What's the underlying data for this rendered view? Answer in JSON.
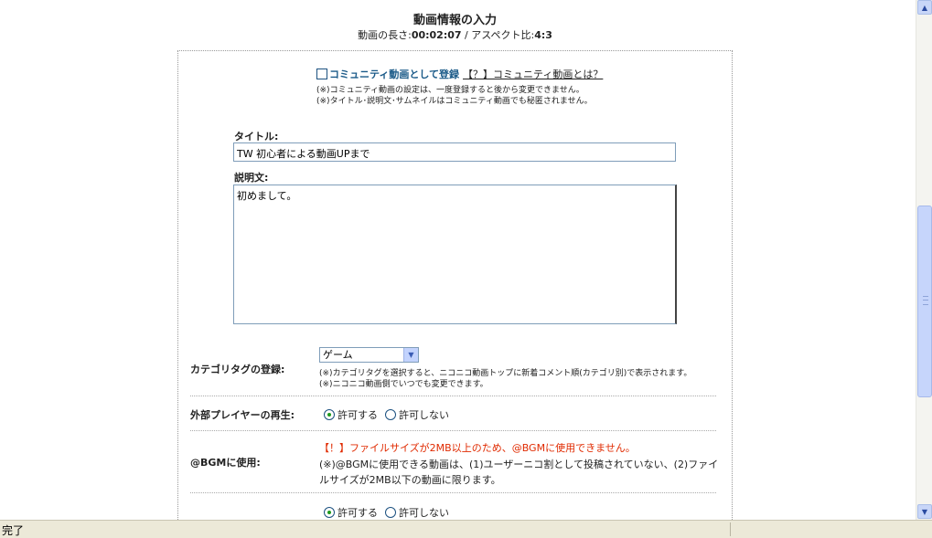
{
  "header": {
    "title": "動画情報の入力",
    "length_label": "動画の長さ:",
    "length_value": "00:02:07",
    "separator": " / ",
    "aspect_label": "アスペクト比:",
    "aspect_value": "4:3"
  },
  "community": {
    "checkbox_label": "コミュニティ動画として登録",
    "help_link": "【？】コミュニティ動画とは？",
    "note_1": "(※)コミュニティ動画の設定は、一度登録すると後から変更できません。",
    "note_2": "(※)タイトル･説明文･サムネイルはコミュニティ動画でも秘匿されません。",
    "checked": false
  },
  "title_field": {
    "label": "タイトル:",
    "value": "TW  初心者による動画UPまで"
  },
  "description_field": {
    "label": "説明文:",
    "value": "初めまして。"
  },
  "category": {
    "label": "カテゴリタグの登録:",
    "selected": "ゲーム",
    "note_1": "(※)カテゴリタグを選択すると、ニコニコ動画トップに新着コメント順(カテゴリ別)で表示されます。",
    "note_2": "(※)ニコニコ動画側でいつでも変更できます。"
  },
  "external_player": {
    "label": "外部プレイヤーの再生:",
    "allow": "許可する",
    "deny": "許可しない",
    "selected": "allow"
  },
  "bgm": {
    "label": "@BGMに使用:",
    "warning": "【！】ファイルサイズが2MB以上のため、@BGMに使用できません。",
    "note_1": "(※)@BGMに使用できる動画は、(1)ユーザーニコ割として投稿されていない、(2)ファイ",
    "note_2": "ルサイズが2MB以下の動画に限ります。"
  },
  "bottom_option": {
    "allow": "許可する",
    "deny": "許可しない",
    "selected": "allow"
  },
  "statusbar": {
    "text": "完了"
  },
  "colors": {
    "community_label": "#1a5a88",
    "warning": "#e02a00",
    "radio_dot": "#1e9a1e"
  }
}
